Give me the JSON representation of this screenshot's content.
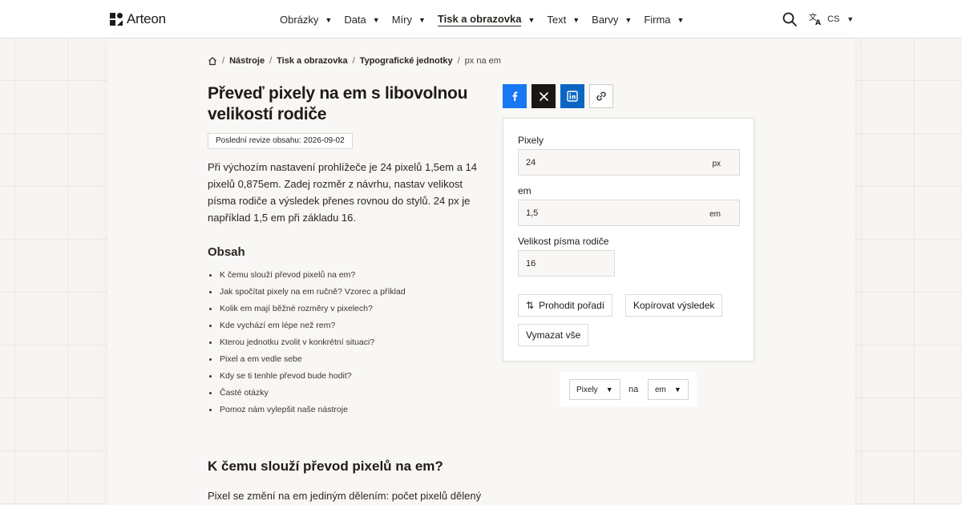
{
  "header": {
    "logo_text": "Arteon",
    "nav": [
      {
        "label": "Obrázky",
        "active": false
      },
      {
        "label": "Data",
        "active": false
      },
      {
        "label": "Míry",
        "active": false
      },
      {
        "label": "Tisk a obrazovka",
        "active": true
      },
      {
        "label": "Text",
        "active": false
      },
      {
        "label": "Barvy",
        "active": false
      },
      {
        "label": "Firma",
        "active": false
      }
    ],
    "language": "CS"
  },
  "breadcrumb": {
    "items": [
      "Nástroje",
      "Tisk a obrazovka",
      "Typografické jednotky"
    ],
    "current": "px na em"
  },
  "article": {
    "title": "Převeď pixely na em s libovolnou velikostí rodiče",
    "revision": "Poslední revize obsahu: 2026-09-02",
    "intro": "Při výchozím nastavení prohlížeče je 24 pixelů 1,5em a 14 pixelů 0,875em. Zadej rozměr z návrhu, nastav velikost písma rodiče a výsledek přenes rovnou do stylů. 24 px je například 1,5 em při základu 16.",
    "toc_title": "Obsah",
    "toc": [
      "K čemu slouží převod pixelů na em?",
      "Jak spočítat pixely na em ručně? Vzorec a příklad",
      "Kolik em mají běžné rozměry v pixelech?",
      "Kde vychází em lépe než rem?",
      "Kterou jednotku zvolit v konkrétní situaci?",
      "Pixel a em vedle sebe",
      "Kdy se ti tenhle převod bude hodit?",
      "Časté otázky",
      "Pomoz nám vylepšit naše nástroje"
    ],
    "section_heading": "K čemu slouží převod pixelů na em?",
    "section_text": "Pixel se změní na em jediným dělením: počet pixelů dělený"
  },
  "share": {
    "icons": [
      "facebook-icon",
      "x-icon",
      "linkedin-icon",
      "link-icon"
    ]
  },
  "converter": {
    "pixels_label": "Pixely",
    "pixels_value": "24",
    "pixels_unit": "px",
    "em_label": "em",
    "em_value": "1,5",
    "em_unit": "em",
    "parent_label": "Velikost písma rodiče",
    "parent_value": "16",
    "swap_label": "Prohodit pořadí",
    "copy_label": "Kopírovat výsledek",
    "clear_label": "Vymazat vše"
  },
  "unit_selector": {
    "from": "Pixely",
    "word": "na",
    "to": "em"
  },
  "colors": {
    "facebook": "#1877f2",
    "x": "#1a1714",
    "linkedin": "#0a66c2",
    "text": "#2a2622"
  }
}
